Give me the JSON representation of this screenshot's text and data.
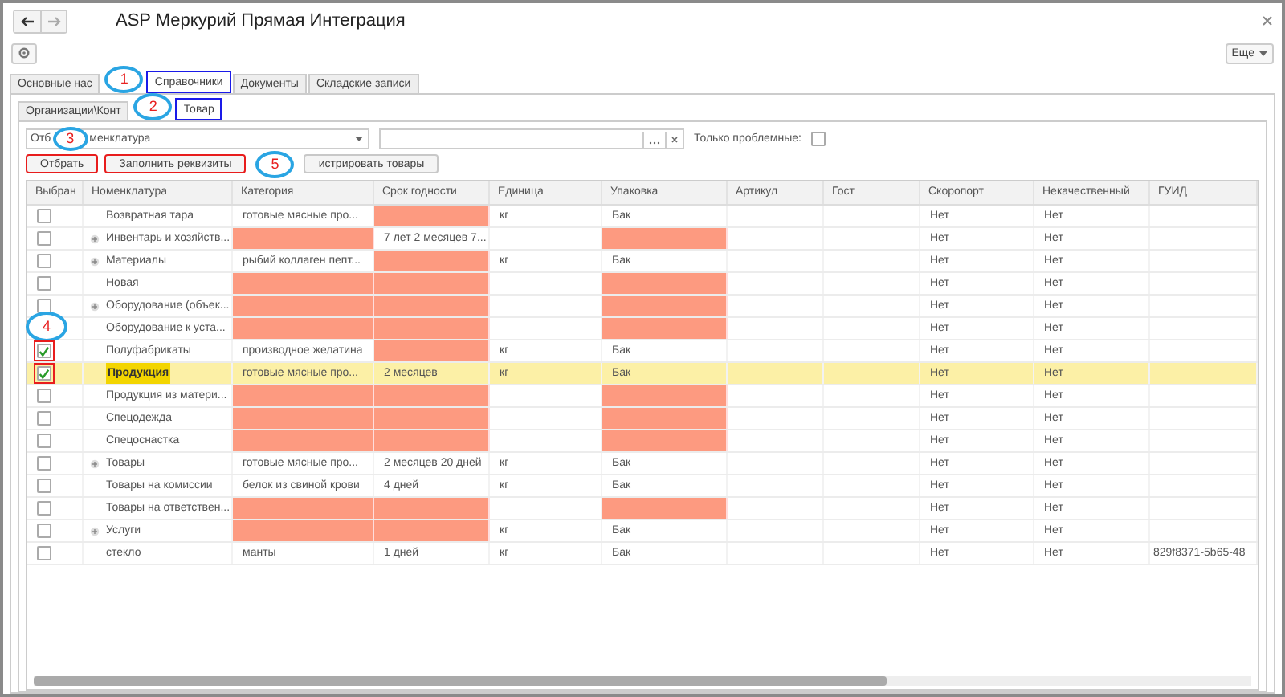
{
  "window": {
    "title": "ASP Меркурий Прямая Интеграция"
  },
  "toolbar": {
    "more_button": "Еще"
  },
  "tabs": [
    {
      "label": "Основные нас",
      "selected": false,
      "outlined": false
    },
    {
      "label": "Справочники",
      "selected": true,
      "outlined": true,
      "callout": "1"
    },
    {
      "label": "Документы",
      "selected": false,
      "outlined": false
    },
    {
      "label": "Складские записи",
      "selected": false,
      "outlined": false
    }
  ],
  "subtabs": [
    {
      "label": "Организации\\Конт",
      "selected": false,
      "outlined": false
    },
    {
      "label": "Товар",
      "selected": true,
      "outlined": true,
      "callout": "2"
    }
  ],
  "filter": {
    "label": "Отб",
    "callout": "3",
    "value": "менклатура",
    "problems_only_label": "Только проблемные:",
    "problems_only_checked": false
  },
  "buttons": [
    {
      "label": "Отбрать",
      "outlined": true
    },
    {
      "label": "Заполнить реквизиты",
      "outlined": true
    },
    {
      "label": "истрировать товары",
      "outlined": false,
      "callout": "5"
    }
  ],
  "table": {
    "columns": [
      "Выбран",
      "Номенклатура",
      "Категория",
      "Срок годности",
      "Единица",
      "Упаковка",
      "Артикул",
      "Гост",
      "Скоропорт",
      "Некачественный",
      "ГУИД"
    ],
    "rows": [
      {
        "checked": false,
        "outlined": false,
        "selected": false,
        "kind": "item",
        "name": "Возвратная тара",
        "category": {
          "text": "готовые мясные про...",
          "problem": false
        },
        "shelf_life": {
          "problem": true
        },
        "unit": {
          "text": "кг",
          "problem": false
        },
        "package": {
          "text": "Бак",
          "problem": false
        },
        "perishable": "Нет",
        "defective": "Нет"
      },
      {
        "checked": false,
        "outlined": false,
        "selected": false,
        "kind": "group",
        "name": "Инвентарь и хозяйств...",
        "category": {
          "problem": true
        },
        "shelf_life": {
          "text": "7 лет 2 месяцев 7...",
          "problem": false
        },
        "unit": {
          "problem": false
        },
        "package": {
          "problem": true
        },
        "perishable": "Нет",
        "defective": "Нет"
      },
      {
        "checked": false,
        "outlined": false,
        "selected": false,
        "kind": "group",
        "name": "Материалы",
        "category": {
          "text": "рыбий коллаген пепт...",
          "problem": false
        },
        "shelf_life": {
          "problem": true
        },
        "unit": {
          "text": "кг",
          "problem": false
        },
        "package": {
          "text": "Бак",
          "problem": false
        },
        "perishable": "Нет",
        "defective": "Нет"
      },
      {
        "checked": false,
        "outlined": false,
        "selected": false,
        "kind": "item",
        "name": "Новая",
        "category": {
          "problem": true
        },
        "shelf_life": {
          "problem": true
        },
        "unit": {
          "problem": false
        },
        "package": {
          "problem": true
        },
        "perishable": "Нет",
        "defective": "Нет"
      },
      {
        "checked": false,
        "outlined": false,
        "selected": false,
        "kind": "group",
        "name": "Оборудование (объек...",
        "category": {
          "problem": true
        },
        "shelf_life": {
          "problem": true
        },
        "unit": {
          "problem": false
        },
        "package": {
          "problem": true
        },
        "perishable": "Нет",
        "defective": "Нет"
      },
      {
        "callout": "4",
        "selected": false,
        "kind": "item",
        "name": "Оборудование к уста...",
        "category": {
          "problem": true
        },
        "shelf_life": {
          "problem": true
        },
        "unit": {
          "problem": false
        },
        "package": {
          "problem": true
        },
        "perishable": "Нет",
        "defective": "Нет"
      },
      {
        "checked": true,
        "outlined": true,
        "selected": false,
        "kind": "item",
        "name": "Полуфабрикаты",
        "category": {
          "text": "производное желатина",
          "problem": false
        },
        "shelf_life": {
          "problem": true
        },
        "unit": {
          "text": "кг",
          "problem": false
        },
        "package": {
          "text": "Бак",
          "problem": false
        },
        "perishable": "Нет",
        "defective": "Нет"
      },
      {
        "checked": true,
        "outlined": true,
        "selected": true,
        "kind": "item",
        "name": "Продукция",
        "category": {
          "text": "готовые мясные про...",
          "problem": false
        },
        "shelf_life": {
          "text": "2 месяцев",
          "problem": false
        },
        "unit": {
          "text": "кг",
          "problem": false
        },
        "package": {
          "text": "Бак",
          "problem": false
        },
        "perishable": "Нет",
        "defective": "Нет"
      },
      {
        "checked": false,
        "outlined": false,
        "selected": false,
        "kind": "item",
        "name": "Продукция из матери...",
        "category": {
          "problem": true
        },
        "shelf_life": {
          "problem": true
        },
        "unit": {
          "problem": false
        },
        "package": {
          "problem": true
        },
        "perishable": "Нет",
        "defective": "Нет"
      },
      {
        "checked": false,
        "outlined": false,
        "selected": false,
        "kind": "item",
        "name": "Спецодежда",
        "category": {
          "problem": true
        },
        "shelf_life": {
          "problem": true
        },
        "unit": {
          "problem": false
        },
        "package": {
          "problem": true
        },
        "perishable": "Нет",
        "defective": "Нет"
      },
      {
        "checked": false,
        "outlined": false,
        "selected": false,
        "kind": "item",
        "name": "Спецоснастка",
        "category": {
          "problem": true
        },
        "shelf_life": {
          "problem": true
        },
        "unit": {
          "problem": false
        },
        "package": {
          "problem": true
        },
        "perishable": "Нет",
        "defective": "Нет"
      },
      {
        "checked": false,
        "outlined": false,
        "selected": false,
        "kind": "group",
        "name": "Товары",
        "category": {
          "text": "готовые мясные про...",
          "problem": false
        },
        "shelf_life": {
          "text": "2 месяцев 20 дней",
          "problem": false
        },
        "unit": {
          "text": "кг",
          "problem": false
        },
        "package": {
          "text": "Бак",
          "problem": false
        },
        "perishable": "Нет",
        "defective": "Нет"
      },
      {
        "checked": false,
        "outlined": false,
        "selected": false,
        "kind": "item",
        "name": "Товары на комиссии",
        "category": {
          "text": "белок из свиной крови",
          "problem": false
        },
        "shelf_life": {
          "text": "4 дней",
          "problem": false
        },
        "unit": {
          "text": "кг",
          "problem": false
        },
        "package": {
          "text": "Бак",
          "problem": false
        },
        "perishable": "Нет",
        "defective": "Нет"
      },
      {
        "checked": false,
        "outlined": false,
        "selected": false,
        "kind": "item",
        "name": "Товары на ответствен...",
        "category": {
          "problem": true
        },
        "shelf_life": {
          "problem": true
        },
        "unit": {
          "problem": false
        },
        "package": {
          "problem": true
        },
        "perishable": "Нет",
        "defective": "Нет"
      },
      {
        "checked": false,
        "outlined": false,
        "selected": false,
        "kind": "group",
        "name": "Услуги",
        "category": {
          "problem": true
        },
        "shelf_life": {
          "problem": true
        },
        "unit": {
          "text": "кг",
          "problem": false
        },
        "package": {
          "text": "Бак",
          "problem": false
        },
        "perishable": "Нет",
        "defective": "Нет"
      },
      {
        "checked": false,
        "outlined": false,
        "selected": false,
        "kind": "item",
        "name": "стекло",
        "category": {
          "text": "манты",
          "problem": false
        },
        "shelf_life": {
          "text": "1 дней",
          "problem": false
        },
        "unit": {
          "text": "кг",
          "problem": false
        },
        "package": {
          "text": "Бак",
          "problem": false
        },
        "perishable": "Нет",
        "defective": "Нет",
        "guid": "829f8371-5b65-48"
      }
    ]
  }
}
